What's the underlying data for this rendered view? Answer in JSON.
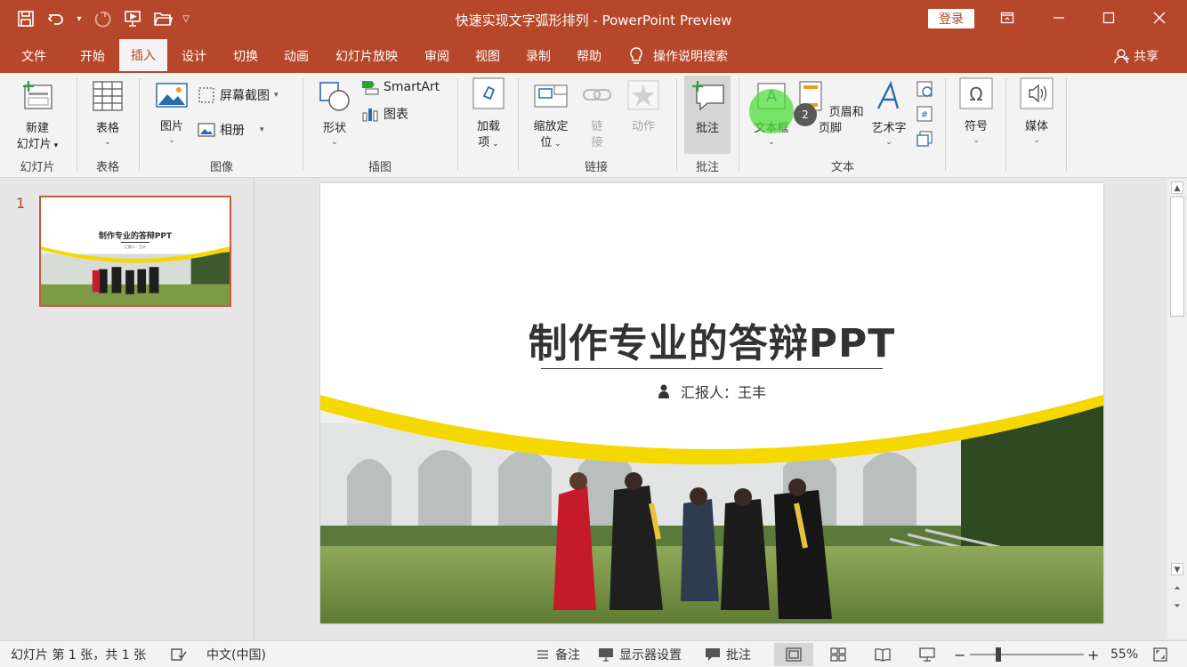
{
  "window": {
    "title": "快速实现文字弧形排列 - PowerPoint Preview",
    "login_label": "登录"
  },
  "tabs": [
    {
      "label": "文件"
    },
    {
      "label": "开始"
    },
    {
      "label": "插入",
      "active": true
    },
    {
      "label": "设计"
    },
    {
      "label": "切换"
    },
    {
      "label": "动画"
    },
    {
      "label": "幻灯片放映"
    },
    {
      "label": "审阅"
    },
    {
      "label": "视图"
    },
    {
      "label": "录制"
    },
    {
      "label": "帮助"
    }
  ],
  "tell_me": "操作说明搜索",
  "share": "共享",
  "ribbon": {
    "groups": {
      "slides": "幻灯片",
      "tables": "表格",
      "images": "图像",
      "illustrations": "插图",
      "addins": "",
      "links": "链接",
      "comments": "批注",
      "text": "文本",
      "symbols": "",
      "media": ""
    },
    "new_slide": [
      "新建",
      "幻灯片"
    ],
    "table": "表格",
    "pictures": "图片",
    "screenshot": "屏幕截图",
    "album": "相册",
    "shapes": "形状",
    "smartart": "SmartArt",
    "chart": "图表",
    "addins": [
      "加载",
      "项"
    ],
    "zoom": [
      "缩放定",
      "位"
    ],
    "link": [
      "链",
      "接"
    ],
    "action": "动作",
    "comment": "批注",
    "textbox": "文本框",
    "header_footer": "页眉和页脚",
    "wordart": "艺术字",
    "symbol": "符号",
    "media": "媒体",
    "step_badge": "2"
  },
  "thumbnails": [
    {
      "number": "1",
      "title": "制作专业的答辩PPT",
      "subtitle": "汇报人：王丰"
    }
  ],
  "slide": {
    "title": "制作专业的答辩PPT",
    "reporter": "汇报人：王丰"
  },
  "status": {
    "slide_info": "幻灯片 第 1 张，共 1 张",
    "language": "中文(中国)",
    "notes": "备注",
    "display_settings": "显示器设置",
    "comments": "批注",
    "zoom_minus": "−",
    "zoom_plus": "+",
    "zoom": "55%",
    "zoom_level_fraction": 0.55
  },
  "colors": {
    "accent": "#b7472a",
    "ribbon_bg": "#f3f3f3",
    "slide_arc_yellow": "#f5d800",
    "highlight_green": "#4fdc3c"
  }
}
